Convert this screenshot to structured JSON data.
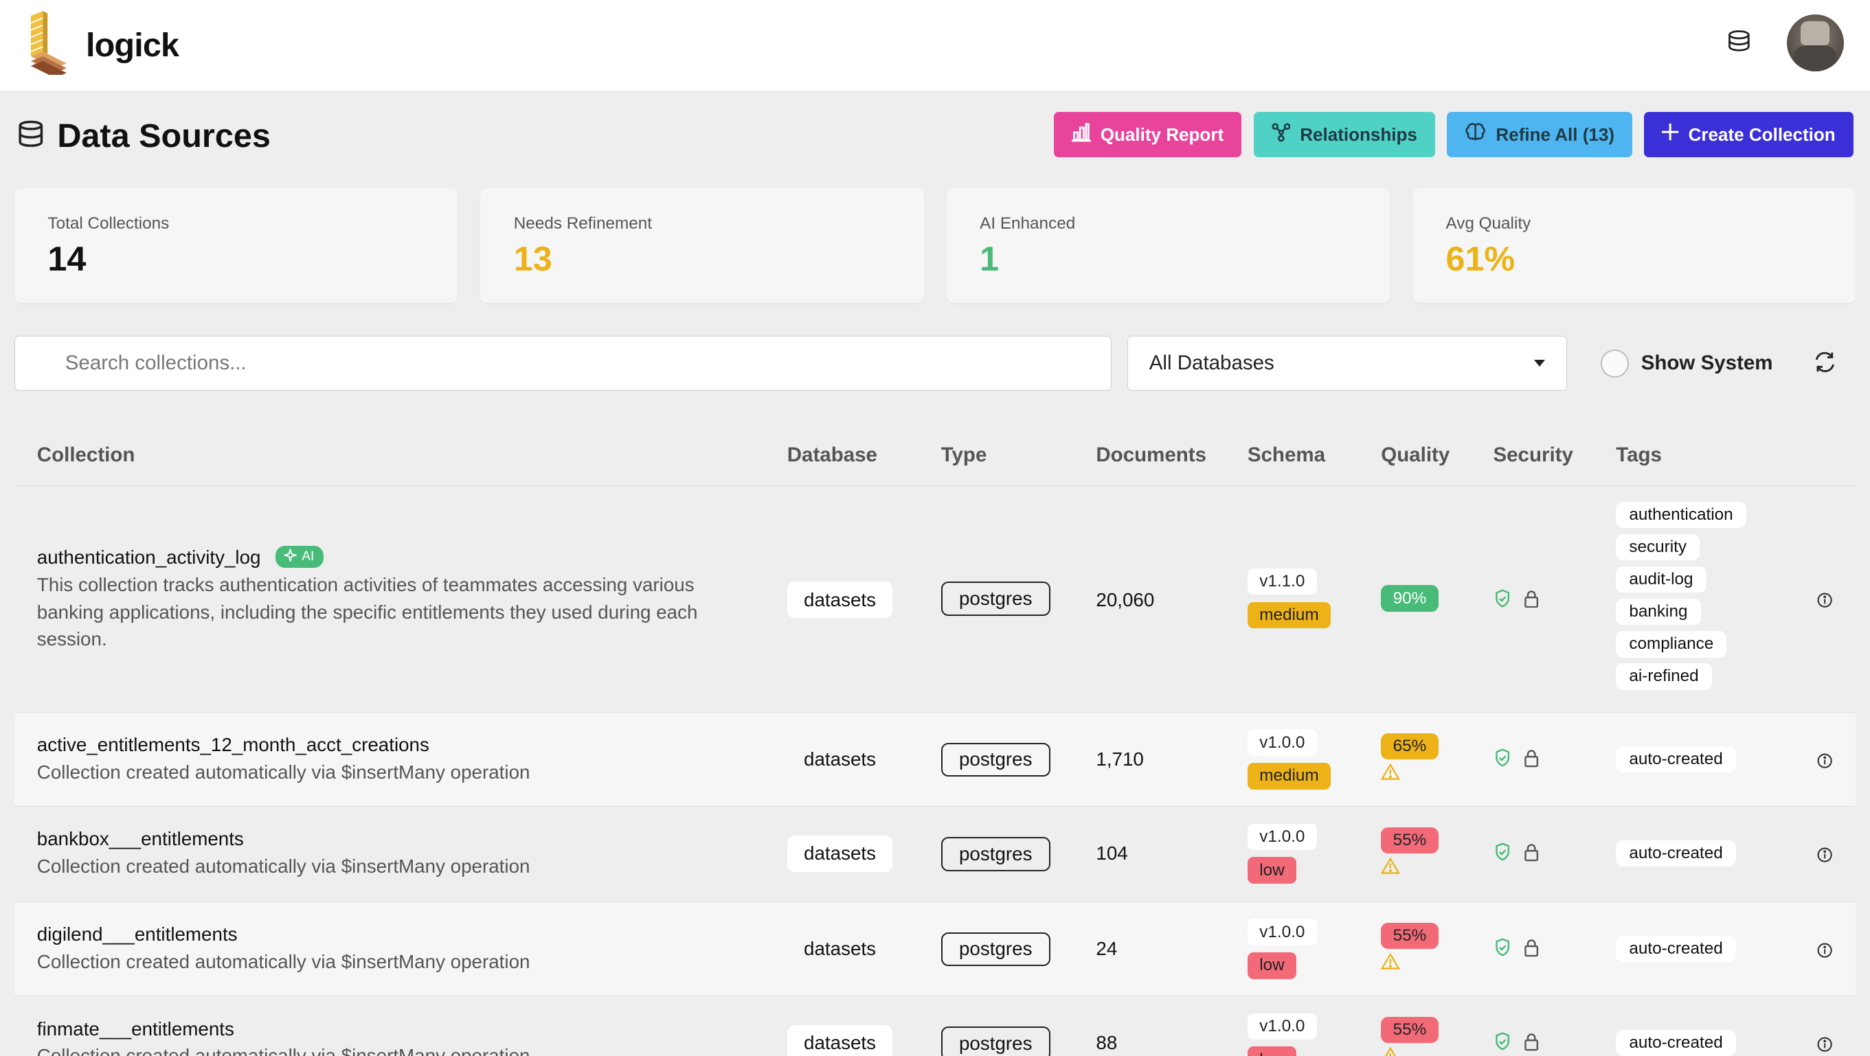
{
  "app": {
    "brand": "logick"
  },
  "header": {
    "title": "Data Sources"
  },
  "actions": {
    "quality_report": "Quality Report",
    "relationships": "Relationships",
    "refine_all": "Refine All (13)",
    "create_collection": "Create Collection"
  },
  "stats": [
    {
      "label": "Total Collections",
      "value": "14",
      "color": "#111111"
    },
    {
      "label": "Needs Refinement",
      "value": "13",
      "color": "#ecb217"
    },
    {
      "label": "AI Enhanced",
      "value": "1",
      "color": "#48bb78"
    },
    {
      "label": "Avg Quality",
      "value": "61%",
      "color": "#ecb217"
    }
  ],
  "filters": {
    "search_placeholder": "Search collections...",
    "database_selected": "All Databases",
    "show_system_label": "Show System",
    "show_system_checked": false
  },
  "table": {
    "columns": [
      "Collection",
      "Database",
      "Type",
      "Documents",
      "Schema",
      "Quality",
      "Security",
      "Tags"
    ],
    "rows": [
      {
        "name": "authentication_activity_log",
        "ai_badge": "AI",
        "description": "This collection tracks authentication activities of teammates accessing various banking applications, including the specific entitlements they used during each session.",
        "database": "datasets",
        "type": "postgres",
        "documents": "20,060",
        "schema_version": "v1.1.0",
        "schema_level": "medium",
        "quality": "90%",
        "quality_warning": false,
        "tags": [
          "authentication",
          "security",
          "audit-log",
          "banking",
          "compliance",
          "ai-refined"
        ]
      },
      {
        "name": "active_entitlements_12_month_acct_creations",
        "description": "Collection created automatically via $insertMany operation",
        "database": "datasets",
        "type": "postgres",
        "documents": "1,710",
        "schema_version": "v1.0.0",
        "schema_level": "medium",
        "quality": "65%",
        "quality_warning": true,
        "tags": [
          "auto-created"
        ]
      },
      {
        "name": "bankbox___entitlements",
        "description": "Collection created automatically via $insertMany operation",
        "database": "datasets",
        "type": "postgres",
        "documents": "104",
        "schema_version": "v1.0.0",
        "schema_level": "low",
        "quality": "55%",
        "quality_warning": true,
        "tags": [
          "auto-created"
        ]
      },
      {
        "name": "digilend___entitlements",
        "description": "Collection created automatically via $insertMany operation",
        "database": "datasets",
        "type": "postgres",
        "documents": "24",
        "schema_version": "v1.0.0",
        "schema_level": "low",
        "quality": "55%",
        "quality_warning": true,
        "tags": [
          "auto-created"
        ]
      },
      {
        "name": "finmate___entitlements",
        "description": "Collection created automatically via $insertMany operation",
        "database": "datasets",
        "type": "postgres",
        "documents": "88",
        "schema_version": "v1.0.0",
        "schema_level": "low",
        "quality": "55%",
        "quality_warning": true,
        "tags": [
          "auto-created"
        ]
      }
    ]
  }
}
